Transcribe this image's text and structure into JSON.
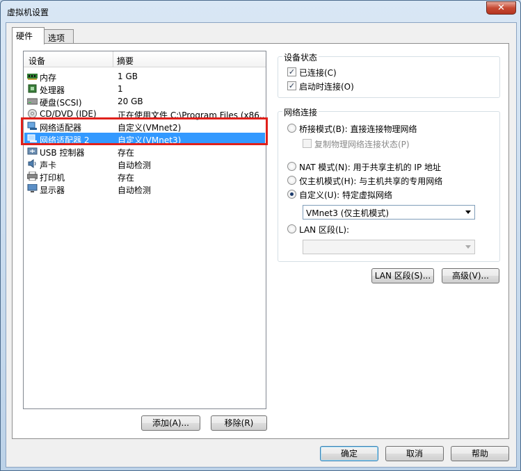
{
  "window": {
    "title": "虚拟机设置",
    "close_glyph": "✕"
  },
  "tabs": [
    {
      "label": "硬件"
    },
    {
      "label": "选项"
    }
  ],
  "device_list": {
    "columns": [
      "设备",
      "摘要"
    ],
    "rows": [
      {
        "name": "内存",
        "summary": "1 GB",
        "icon": "memory-icon"
      },
      {
        "name": "处理器",
        "summary": "1",
        "icon": "processor-icon"
      },
      {
        "name": "硬盘(SCSI)",
        "summary": "20 GB",
        "icon": "harddisk-icon"
      },
      {
        "name": "CD/DVD (IDE)",
        "summary": "正在使用文件 C:\\Program Files (x86...",
        "icon": "cd-dvd-icon"
      },
      {
        "name": "网络适配器",
        "summary": "自定义(VMnet2)",
        "icon": "network-adapter-icon"
      },
      {
        "name": "网络适配器 2",
        "summary": "自定义(VMnet3)",
        "icon": "network-adapter-icon"
      },
      {
        "name": "USB 控制器",
        "summary": "存在",
        "icon": "usb-icon"
      },
      {
        "name": "声卡",
        "summary": "自动检测",
        "icon": "sound-icon"
      },
      {
        "name": "打印机",
        "summary": "存在",
        "icon": "printer-icon"
      },
      {
        "name": "显示器",
        "summary": "自动检测",
        "icon": "display-icon"
      }
    ],
    "selected_index": 5
  },
  "list_buttons": {
    "add": "添加(A)...",
    "remove": "移除(R)"
  },
  "device_status": {
    "title": "设备状态",
    "connected": {
      "label": "已连接(C)",
      "checked": true
    },
    "connect_at_power_on": {
      "label": "启动时连接(O)",
      "checked": true
    }
  },
  "network_connection": {
    "title": "网络连接",
    "bridged": {
      "label": "桥接模式(B): 直接连接物理网络",
      "checked": false
    },
    "replicate": {
      "label": "复制物理网络连接状态(P)",
      "checked": false,
      "enabled": false
    },
    "nat": {
      "label": "NAT 模式(N): 用于共享主机的 IP 地址",
      "checked": false
    },
    "host_only": {
      "label": "仅主机模式(H): 与主机共享的专用网络",
      "checked": false
    },
    "custom": {
      "label": "自定义(U): 特定虚拟网络",
      "checked": true
    },
    "custom_select": "VMnet3 (仅主机模式)",
    "lan_segment": {
      "label": "LAN 区段(L):",
      "checked": false
    },
    "lan_select": ""
  },
  "panel_buttons": {
    "lan_segments": "LAN 区段(S)...",
    "advanced": "高级(V)..."
  },
  "dialog_buttons": {
    "ok": "确定",
    "cancel": "取消",
    "help": "帮助"
  },
  "colors": {
    "selection": "#3399ff",
    "annotation": "#e0201b"
  }
}
